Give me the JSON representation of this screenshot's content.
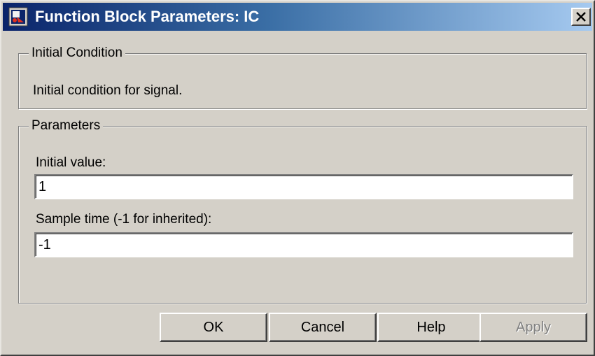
{
  "window": {
    "title": "Function Block Parameters: IC",
    "app_icon": "simulink-block-icon",
    "close_icon": "close-x-icon"
  },
  "initial_condition_group": {
    "legend": "Initial Condition",
    "description": "Initial condition for signal."
  },
  "parameters_group": {
    "legend": "Parameters",
    "initial_value": {
      "label": "Initial value:",
      "value": "1"
    },
    "sample_time": {
      "label": "Sample time (-1 for inherited):",
      "value": "-1"
    }
  },
  "buttons": {
    "ok": "OK",
    "cancel": "Cancel",
    "help": "Help",
    "apply": "Apply"
  },
  "colors": {
    "titlebar_start": "#0a246a",
    "titlebar_end": "#a6caf0",
    "dialog_face": "#d4d0c8",
    "disabled_text": "#808080"
  }
}
